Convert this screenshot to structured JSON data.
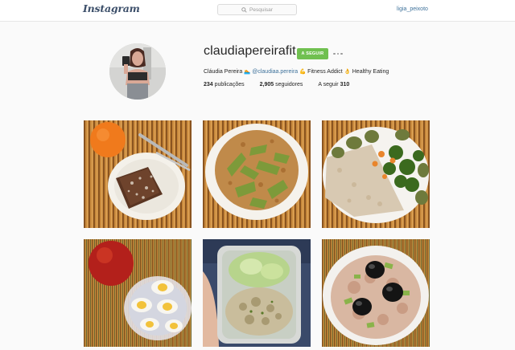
{
  "app": {
    "logo": "Instagram"
  },
  "search": {
    "placeholder": "Pesquisar"
  },
  "current_user": {
    "username": "ligia_peixoto"
  },
  "profile": {
    "handle": "claudiapereirafit",
    "follow_label": "A SEGUIR",
    "bio": {
      "name": "Cláudia Pereira",
      "emoji1": "🏊",
      "mention": "@claudiaa.pereira",
      "emoji2": "💪",
      "text1": "Fitness Addict",
      "emoji3": "👌",
      "text2": "Healthy Eating"
    },
    "stats": {
      "posts_count": "234",
      "posts_label": "publicações",
      "followers_count": "2,905",
      "followers_label": "seguidores",
      "following_label": "A seguir",
      "following_count": "310"
    }
  },
  "posts": [
    {
      "subject": "orange-and-cake-plate"
    },
    {
      "subject": "zucchini-with-cinnamon-plate"
    },
    {
      "subject": "chicken-and-vegetables-plate"
    },
    {
      "subject": "apple-and-boiled-eggs"
    },
    {
      "subject": "chicken-salad-container"
    },
    {
      "subject": "tuna-salad-with-olives"
    }
  ]
}
